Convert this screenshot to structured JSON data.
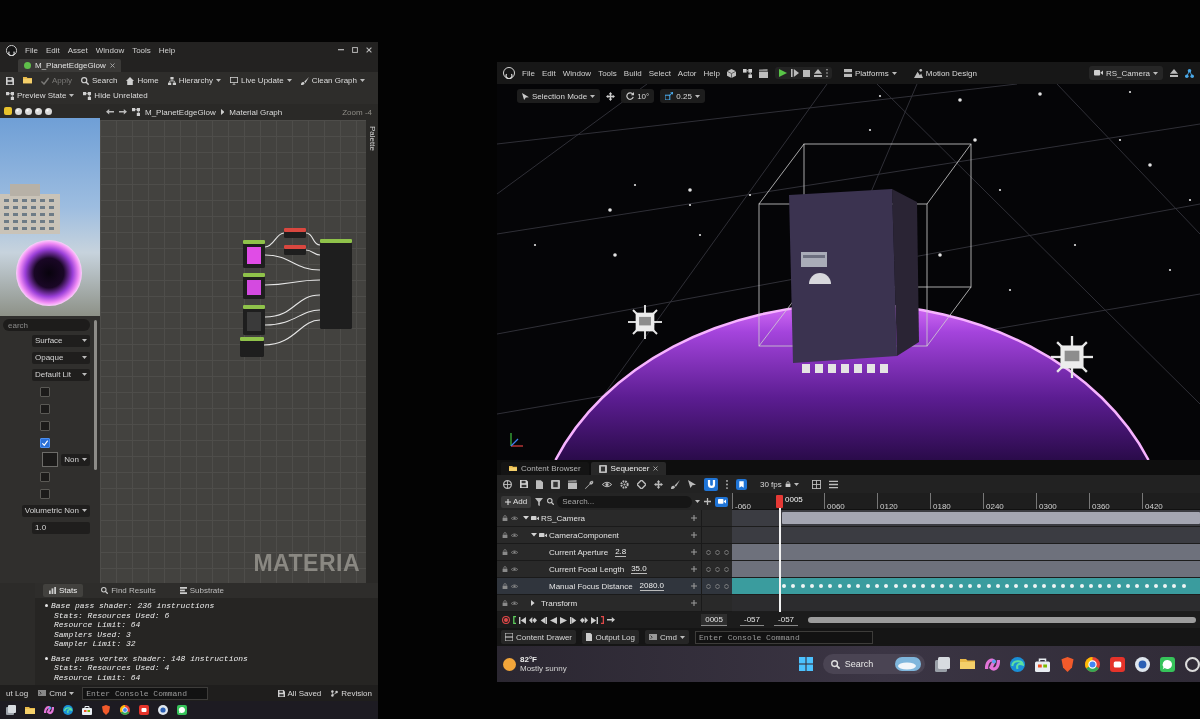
{
  "left_monitor": {
    "menu": [
      "File",
      "Edit",
      "Asset",
      "Window",
      "Tools",
      "Help"
    ],
    "asset_tab": "M_PlanetEdgeGlow",
    "toolbar": [
      {
        "label": "Apply",
        "disabled": true,
        "dropdown": false
      },
      {
        "label": "Search",
        "disabled": false,
        "dropdown": false
      },
      {
        "label": "Home",
        "disabled": false,
        "dropdown": false
      },
      {
        "label": "Hierarchy",
        "disabled": false,
        "dropdown": true
      },
      {
        "label": "Live Update",
        "disabled": false,
        "dropdown": true
      },
      {
        "label": "Clean Graph",
        "disabled": false,
        "dropdown": true
      },
      {
        "label": "Preview State",
        "disabled": false,
        "dropdown": true
      },
      {
        "label": "Hide Unrelated",
        "disabled": false,
        "dropdown": false
      }
    ],
    "breadcrumb": [
      "M_PlanetEdgeGlow",
      "Material Graph"
    ],
    "zoom": "Zoom -4",
    "palette": "Palette",
    "details": {
      "search_placeholder": "earch",
      "fields": [
        {
          "kind": "dropdown",
          "value": "Surface"
        },
        {
          "kind": "dropdown",
          "value": "Opaque"
        },
        {
          "kind": "dropdown",
          "value": "Default Lit"
        },
        {
          "kind": "checkbox",
          "checked": false
        },
        {
          "kind": "checkbox",
          "checked": false
        },
        {
          "kind": "checkbox",
          "checked": false
        },
        {
          "kind": "checkbox",
          "checked": true
        },
        {
          "kind": "texture",
          "value": "Non"
        },
        {
          "kind": "checkbox",
          "checked": false
        },
        {
          "kind": "checkbox",
          "checked": false
        },
        {
          "kind": "dropdown",
          "value": "Volumetric Non"
        },
        {
          "kind": "number",
          "value": "1.0"
        }
      ]
    },
    "graph_label": "MATERIA",
    "stats": {
      "tabs": [
        {
          "label": "Stats",
          "selected": true
        },
        {
          "label": "Find Results",
          "selected": false
        },
        {
          "label": "Substrate",
          "selected": false
        }
      ],
      "lines": [
        {
          "text": "Base pass shader: 236 instructions",
          "bullet": true
        },
        {
          "text": "Stats: Resources Used: 6",
          "bullet": false
        },
        {
          "text": "Resource Limit: 64",
          "bullet": false
        },
        {
          "text": "Samplers Used: 3",
          "bullet": false
        },
        {
          "text": "Sampler Limit: 32",
          "bullet": false
        },
        {
          "text": "Base pass vertex shader: 148 instructions",
          "bullet": true
        },
        {
          "text": "Stats: Resources Used: 4",
          "bullet": false
        },
        {
          "text": "Resource Limit: 64",
          "bullet": false
        }
      ]
    },
    "bottom_bar": {
      "log_tab": "ut Log",
      "cmd": "Cmd",
      "console_placeholder": "Enter Console Command",
      "saved": "All Saved",
      "revision": "Revision"
    }
  },
  "right_monitor": {
    "menu": [
      "File",
      "Edit",
      "Window",
      "Tools",
      "Build",
      "Select",
      "Actor",
      "Help"
    ],
    "toolbar": {
      "platforms": "Platforms",
      "motion_design": "Motion Design",
      "camera": "RS_Camera"
    },
    "viewport_toolbar": {
      "mode": "Selection Mode",
      "rotation_snap": "10°",
      "scale_snap": "0.25"
    },
    "sequencer": {
      "tabs": [
        {
          "label": "Content Browser",
          "selected": false
        },
        {
          "label": "Sequencer",
          "selected": true
        }
      ],
      "snapping": true,
      "frame_rate": "30 fps",
      "add_label": "Add",
      "search_placeholder": "Search...",
      "tracks": [
        {
          "name": "RS_Camera",
          "expanded": true,
          "selected": false,
          "children": [
            {
              "name": "CameraComponent",
              "expanded": true,
              "selected": false,
              "children": [
                {
                  "name": "Current Aperture",
                  "value": "2.8",
                  "selected": false
                },
                {
                  "name": "Current Focal Length",
                  "value": "35.0",
                  "selected": false
                },
                {
                  "name": "Manual Focus Distance",
                  "value": "2080.0",
                  "selected": true
                }
              ]
            },
            {
              "name": "Transform",
              "expanded": false,
              "selected": false
            }
          ]
        }
      ],
      "ruler": {
        "current": "0005",
        "ticks": [
          "-060",
          "0060",
          "0120",
          "0180",
          "0240",
          "0300",
          "0360",
          "0420"
        ]
      },
      "transport": {
        "frame": "0005",
        "start": "-057",
        "end": "-057"
      }
    },
    "status_bar": {
      "buttons": [
        "Content Drawer",
        "Output Log"
      ],
      "cmd": "Cmd",
      "console_placeholder": "Enter Console Command"
    },
    "taskbar": {
      "temperature": "82°F",
      "weather": "Mostly sunny",
      "search": "Search"
    }
  }
}
